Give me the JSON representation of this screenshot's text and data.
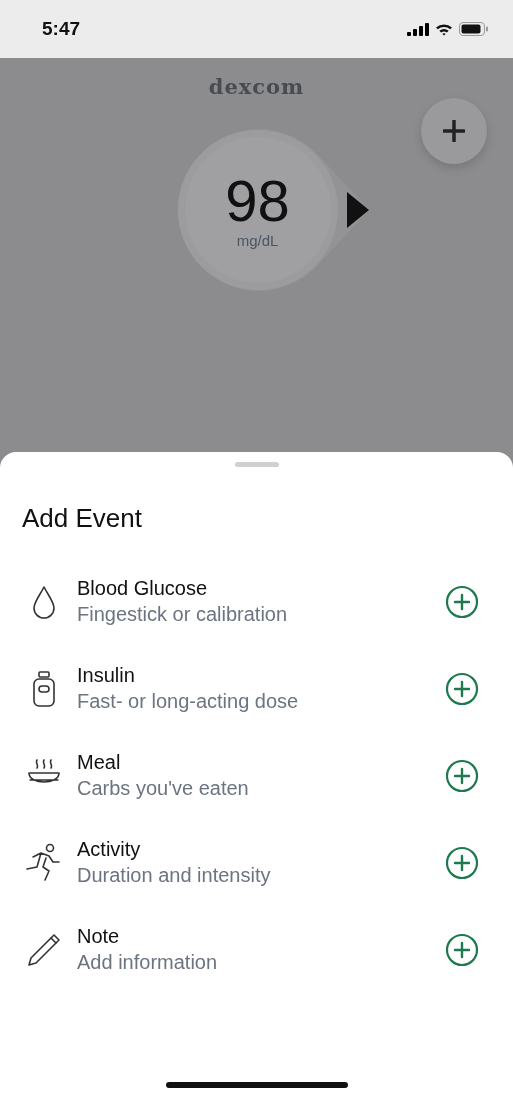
{
  "status_bar": {
    "time": "5:47"
  },
  "header": {
    "logo": "dexcom"
  },
  "reading": {
    "value": "98",
    "unit": "mg/dL"
  },
  "sheet": {
    "title": "Add Event",
    "events": [
      {
        "kind": "glucose",
        "title": "Blood Glucose",
        "subtitle": "Fingestick or calibration"
      },
      {
        "kind": "insulin",
        "title": "Insulin",
        "subtitle": "Fast- or long-acting dose"
      },
      {
        "kind": "meal",
        "title": "Meal",
        "subtitle": "Carbs you've eaten"
      },
      {
        "kind": "activity",
        "title": "Activity",
        "subtitle": "Duration and intensity"
      },
      {
        "kind": "note",
        "title": "Note",
        "subtitle": "Add information"
      }
    ]
  }
}
